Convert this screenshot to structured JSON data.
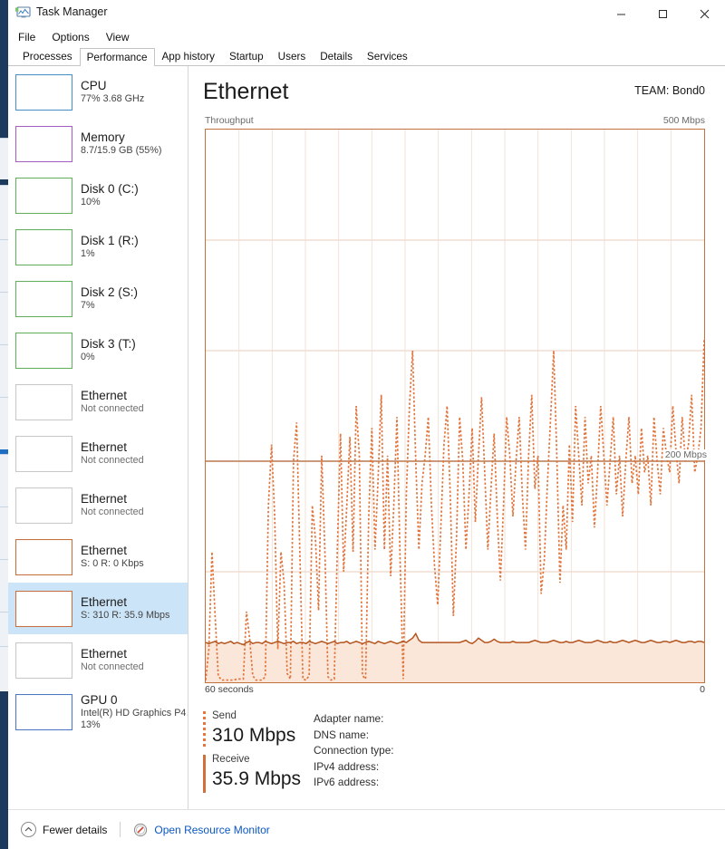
{
  "window": {
    "title": "Task Manager",
    "icon": "task-manager-icon",
    "minimize": "─",
    "maximize": "□",
    "close": "✕"
  },
  "menubar": {
    "items": [
      "File",
      "Options",
      "View"
    ]
  },
  "tabs": [
    {
      "label": "Processes",
      "active": false
    },
    {
      "label": "Performance",
      "active": true
    },
    {
      "label": "App history",
      "active": false
    },
    {
      "label": "Startup",
      "active": false
    },
    {
      "label": "Users",
      "active": false
    },
    {
      "label": "Details",
      "active": false
    },
    {
      "label": "Services",
      "active": false
    }
  ],
  "sidebar": {
    "items": [
      {
        "title": "CPU",
        "sub": "77%  3.68 GHz",
        "accent": "#4a90c4",
        "selected": false,
        "kind": "cpu"
      },
      {
        "title": "Memory",
        "sub": "8.7/15.9 GB (55%)",
        "accent": "#a65ec1",
        "selected": false,
        "kind": "memory"
      },
      {
        "title": "Disk 0 (C:)",
        "sub": "10%",
        "accent": "#62b15a",
        "selected": false,
        "kind": "disk0"
      },
      {
        "title": "Disk 1 (R:)",
        "sub": "1%",
        "accent": "#62b15a",
        "selected": false,
        "kind": "disk1"
      },
      {
        "title": "Disk 2 (S:)",
        "sub": "7%",
        "accent": "#62b15a",
        "selected": false,
        "kind": "disk2"
      },
      {
        "title": "Disk 3 (T:)",
        "sub": "0%",
        "accent": "#62b15a",
        "selected": false,
        "kind": "disk3"
      },
      {
        "title": "Ethernet",
        "sub": "Not connected",
        "accent": "#c8c8c8",
        "selected": false,
        "kind": "empty"
      },
      {
        "title": "Ethernet",
        "sub": "Not connected",
        "accent": "#c8c8c8",
        "selected": false,
        "kind": "empty"
      },
      {
        "title": "Ethernet",
        "sub": "Not connected",
        "accent": "#c8c8c8",
        "selected": false,
        "kind": "empty"
      },
      {
        "title": "Ethernet",
        "sub": "S: 0 R: 0 Kbps",
        "accent": "#c4703f",
        "selected": false,
        "kind": "net-idle"
      },
      {
        "title": "Ethernet",
        "sub": "S: 310 R: 35.9 Mbps",
        "accent": "#c4703f",
        "selected": true,
        "kind": "net-active"
      },
      {
        "title": "Ethernet",
        "sub": "Not connected",
        "accent": "#c8c8c8",
        "selected": false,
        "kind": "empty"
      },
      {
        "title": "GPU 0",
        "sub": "Intel(R) HD Graphics P4…",
        "sub2": "13%",
        "accent": "#4a78c4",
        "selected": false,
        "kind": "gpu"
      }
    ]
  },
  "main": {
    "title": "Ethernet",
    "subtitle": "TEAM: Bond0",
    "graph_label_left": "Throughput",
    "graph_label_right": "500 Mbps",
    "midline_label": "200 Mbps",
    "axis_left": "60 seconds",
    "axis_right": "0",
    "stats": [
      {
        "label": "Send",
        "value": "310 Mbps",
        "style": "dotted"
      },
      {
        "label": "Receive",
        "value": "35.9 Mbps",
        "style": "solid"
      }
    ],
    "info": [
      "Adapter name:",
      "DNS name:",
      "Connection type:",
      "IPv4 address:",
      "IPv6 address:"
    ]
  },
  "footer": {
    "fewer_details": "Fewer details",
    "chevron": "∧",
    "resource_monitor": "Open Resource Monitor",
    "resource_monitor_icon": "resource-monitor-icon"
  },
  "colors": {
    "send_line": "#e0753d",
    "receive_line": "#b4551f",
    "receive_fill": "#fbe7d9",
    "grid": "#f0ded2",
    "border": "#c4703f",
    "midline": "#c28b68",
    "selection": "#cce4f7"
  },
  "chart_data": {
    "type": "line",
    "title": "Ethernet Throughput",
    "xlabel": "60 seconds",
    "ylabel": "Throughput",
    "ylim": [
      0,
      500
    ],
    "xlim": [
      60,
      0
    ],
    "grid": true,
    "gridlines_y": [
      100,
      200,
      300,
      400
    ],
    "gridlines_x_count": 15,
    "annotations": [
      {
        "text": "500 Mbps",
        "y": 500,
        "position": "top-right"
      },
      {
        "text": "200 Mbps",
        "y": 200,
        "position": "right"
      }
    ],
    "series": [
      {
        "name": "Send",
        "style": "dotted",
        "color": "#e0753d",
        "current": 310,
        "unit": "Mbps",
        "values": [
          2,
          30,
          118,
          60,
          6,
          2,
          2,
          2,
          2,
          2,
          3,
          3,
          3,
          64,
          40,
          6,
          2,
          2,
          2,
          5,
          160,
          215,
          150,
          30,
          118,
          90,
          8,
          3,
          200,
          235,
          120,
          3,
          2,
          6,
          160,
          130,
          65,
          205,
          120,
          5,
          2,
          3,
          122,
          225,
          100,
          160,
          222,
          118,
          250,
          205,
          6,
          3,
          150,
          230,
          120,
          185,
          260,
          120,
          205,
          96,
          160,
          240,
          112,
          3,
          170,
          250,
          300,
          200,
          120,
          180,
          205,
          240,
          160,
          105,
          70,
          140,
          215,
          250,
          170,
          60,
          130,
          240,
          200,
          120,
          170,
          230,
          145,
          205,
          258,
          190,
          120,
          175,
          225,
          150,
          92,
          160,
          240,
          205,
          150,
          200,
          240,
          170,
          120,
          205,
          260,
          175,
          205,
          80,
          110,
          180,
          238,
          300,
          205,
          90,
          160,
          120,
          215,
          145,
          250,
          205,
          160,
          240,
          180,
          205,
          140,
          190,
          250,
          205,
          160,
          200,
          240,
          170,
          205,
          150,
          200,
          240,
          180,
          205,
          170,
          230,
          190,
          205,
          160,
          240,
          200,
          170,
          230,
          205,
          190,
          250,
          210,
          180,
          240,
          200,
          215,
          260,
          190,
          205,
          230,
          310
        ]
      },
      {
        "name": "Receive",
        "style": "solid-filled",
        "color": "#b4551f",
        "fill": "#fbe7d9",
        "current": 35.9,
        "unit": "Mbps",
        "values": [
          36,
          35,
          36,
          37,
          35,
          36,
          35,
          36,
          37,
          35,
          36,
          35,
          34,
          36,
          37,
          35,
          36,
          36,
          35,
          37,
          36,
          35,
          36,
          37,
          36,
          35,
          36,
          36,
          37,
          35,
          36,
          36,
          35,
          37,
          36,
          35,
          36,
          37,
          36,
          35,
          36,
          37,
          35,
          36,
          36,
          37,
          35,
          36,
          37,
          36,
          35,
          36,
          37,
          36,
          35,
          37,
          36,
          35,
          36,
          37,
          36,
          35,
          36,
          37,
          36,
          38,
          40,
          44,
          38,
          36,
          36,
          36,
          36,
          36,
          36,
          36,
          36,
          36,
          36,
          36,
          36,
          36,
          37,
          38,
          36,
          35,
          37,
          40,
          38,
          36,
          36,
          37,
          39,
          37,
          36,
          36,
          36,
          36,
          37,
          36,
          36,
          36,
          36,
          36,
          37,
          38,
          37,
          36,
          36,
          36,
          37,
          38,
          37,
          36,
          36,
          37,
          36,
          36,
          37,
          38,
          37,
          36,
          36,
          36,
          37,
          38,
          37,
          36,
          36,
          37,
          36,
          36,
          37,
          38,
          37,
          36,
          37,
          38,
          37,
          36,
          36,
          37,
          38,
          37,
          36,
          36,
          37,
          37,
          36,
          37,
          38,
          37,
          36,
          36,
          37,
          37,
          36,
          37,
          37,
          36
        ]
      }
    ]
  }
}
